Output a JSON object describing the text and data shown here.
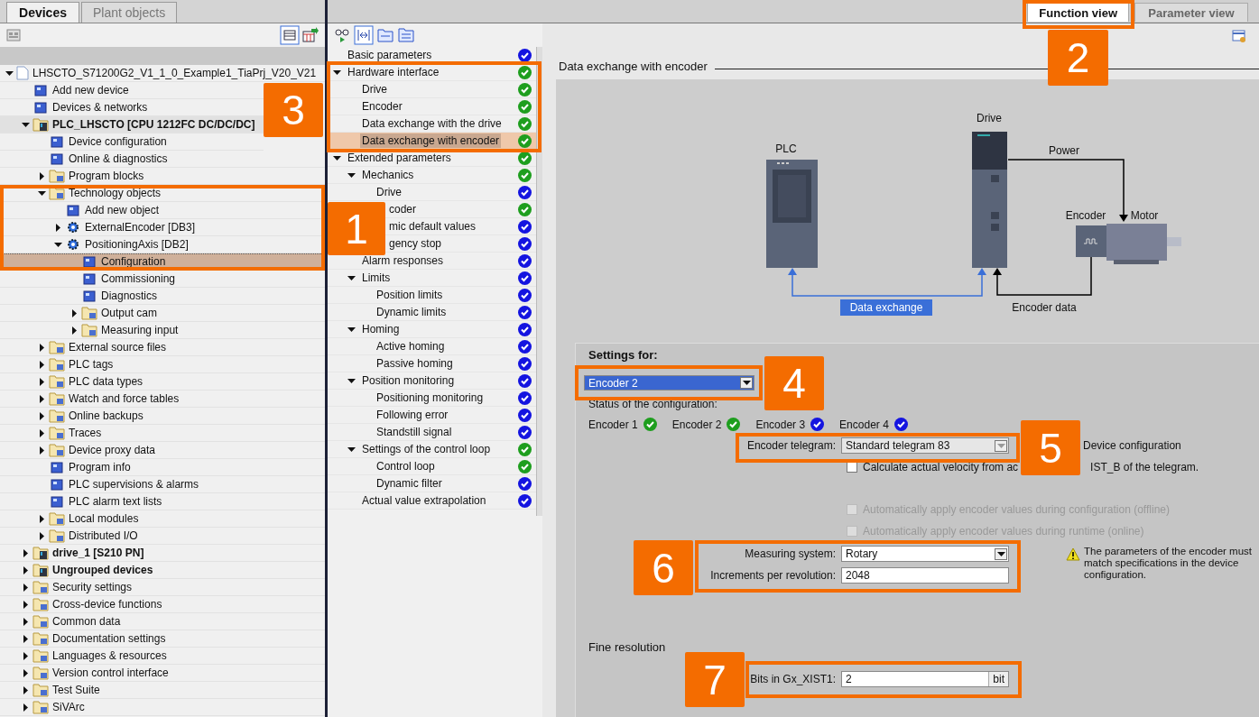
{
  "explorer": {
    "tabs": [
      {
        "label": "Devices",
        "selected": true
      },
      {
        "label": "Plant objects",
        "selected": false
      }
    ],
    "tree": [
      {
        "label": "LHSCTO_S71200G2_V1_1_0_Example1_TiaPrj_V20_V21",
        "kind": "root",
        "expanded": true,
        "selected": false,
        "children": [
          {
            "label": "Add new device",
            "kind": "item",
            "selected": false
          },
          {
            "label": "Devices & networks",
            "kind": "item",
            "selected": false
          },
          {
            "label": "PLC_LHSCTO [CPU 1212FC DC/DC/DC]",
            "kind": "device",
            "expanded": true,
            "selected": false,
            "children": [
              {
                "label": "Device configuration",
                "kind": "item",
                "selected": false
              },
              {
                "label": "Online & diagnostics",
                "kind": "item",
                "selected": false
              },
              {
                "label": "Program blocks",
                "kind": "folder",
                "expanded": false,
                "selected": false
              },
              {
                "label": "Technology objects",
                "kind": "folder",
                "expanded": true,
                "selected": false,
                "children": [
                  {
                    "label": "Add new object",
                    "kind": "item",
                    "selected": false
                  },
                  {
                    "label": "ExternalEncoder [DB3]",
                    "kind": "object",
                    "expanded": false,
                    "selected": false
                  },
                  {
                    "label": "PositioningAxis [DB2]",
                    "kind": "object",
                    "expanded": true,
                    "selected": false,
                    "children": [
                      {
                        "label": "Configuration",
                        "kind": "item",
                        "selected": true
                      },
                      {
                        "label": "Commissioning",
                        "kind": "item",
                        "selected": false
                      },
                      {
                        "label": "Diagnostics",
                        "kind": "item",
                        "selected": false
                      },
                      {
                        "label": "Output cam",
                        "kind": "folder",
                        "expanded": false,
                        "selected": false
                      },
                      {
                        "label": "Measuring input",
                        "kind": "folder",
                        "expanded": false,
                        "selected": false
                      }
                    ]
                  }
                ]
              },
              {
                "label": "External source files",
                "kind": "folder",
                "expanded": false,
                "selected": false
              },
              {
                "label": "PLC tags",
                "kind": "folder",
                "expanded": false,
                "selected": false
              },
              {
                "label": "PLC data types",
                "kind": "folder",
                "expanded": false,
                "selected": false
              },
              {
                "label": "Watch and force tables",
                "kind": "folder",
                "expanded": false,
                "selected": false
              },
              {
                "label": "Online backups",
                "kind": "folder",
                "expanded": false,
                "selected": false
              },
              {
                "label": "Traces",
                "kind": "folder",
                "expanded": false,
                "selected": false
              },
              {
                "label": "Device proxy data",
                "kind": "folder",
                "expanded": false,
                "selected": false
              },
              {
                "label": "Program info",
                "kind": "item",
                "selected": false
              },
              {
                "label": "PLC supervisions & alarms",
                "kind": "item",
                "selected": false
              },
              {
                "label": "PLC alarm text lists",
                "kind": "item",
                "selected": false
              },
              {
                "label": "Local modules",
                "kind": "folder",
                "expanded": false,
                "selected": false
              },
              {
                "label": "Distributed I/O",
                "kind": "folder",
                "expanded": false,
                "selected": false
              }
            ]
          },
          {
            "label": "drive_1 [S210 PN]",
            "kind": "device",
            "expanded": false,
            "selected": false
          },
          {
            "label": "Ungrouped devices",
            "kind": "device",
            "expanded": false,
            "selected": false
          },
          {
            "label": "Security settings",
            "kind": "folder",
            "expanded": false,
            "selected": false
          },
          {
            "label": "Cross-device functions",
            "kind": "folder",
            "expanded": false,
            "selected": false
          },
          {
            "label": "Common data",
            "kind": "folder",
            "expanded": false,
            "selected": false
          },
          {
            "label": "Documentation settings",
            "kind": "folder",
            "expanded": false,
            "selected": false
          },
          {
            "label": "Languages & resources",
            "kind": "folder",
            "expanded": false,
            "selected": false
          },
          {
            "label": "Version control interface",
            "kind": "folder",
            "expanded": false,
            "selected": false
          },
          {
            "label": "Test Suite",
            "kind": "folder",
            "expanded": false,
            "selected": false
          },
          {
            "label": "SiVArc",
            "kind": "folder",
            "expanded": false,
            "selected": false
          }
        ]
      }
    ]
  },
  "navigation": [
    {
      "label": "Basic parameters",
      "color": "#1414e0",
      "selected": false
    },
    {
      "label": "Hardware interface",
      "color": "#1e9e1e",
      "expanded": true,
      "selected": false,
      "children": [
        {
          "label": "Drive",
          "color": "#1e9e1e",
          "selected": false
        },
        {
          "label": "Encoder",
          "color": "#1e9e1e",
          "selected": false
        },
        {
          "label": "Data exchange with the drive",
          "color": "#1e9e1e",
          "selected": false
        },
        {
          "label": "Data exchange with encoder",
          "color": "#1e9e1e",
          "selected": true
        }
      ]
    },
    {
      "label": "Extended parameters",
      "color": "#1e9e1e",
      "expanded": true,
      "selected": false,
      "children": [
        {
          "label": "Mechanics",
          "color": "#1e9e1e",
          "expanded": true,
          "selected": false,
          "children": [
            {
              "label": "Drive",
              "color": "#1414e0",
              "selected": false
            },
            {
              "label": "coder",
              "color": "#1e9e1e",
              "selected": false
            }
          ]
        },
        {
          "label": "mic default values",
          "color": "#1414e0",
          "selected": false
        },
        {
          "label": "gency stop",
          "color": "#1414e0",
          "selected": false
        },
        {
          "label": "Alarm responses",
          "color": "#1414e0",
          "selected": false
        },
        {
          "label": "Limits",
          "color": "#1414e0",
          "expanded": true,
          "selected": false,
          "children": [
            {
              "label": "Position limits",
              "color": "#1414e0",
              "selected": false
            },
            {
              "label": "Dynamic limits",
              "color": "#1414e0",
              "selected": false
            }
          ]
        },
        {
          "label": "Homing",
          "color": "#1414e0",
          "expanded": true,
          "selected": false,
          "children": [
            {
              "label": "Active homing",
              "color": "#1414e0",
              "selected": false
            },
            {
              "label": "Passive homing",
              "color": "#1414e0",
              "selected": false
            }
          ]
        },
        {
          "label": "Position monitoring",
          "color": "#1414e0",
          "expanded": true,
          "selected": false,
          "children": [
            {
              "label": "Positioning monitoring",
              "color": "#1414e0",
              "selected": false
            },
            {
              "label": "Following error",
              "color": "#1414e0",
              "selected": false
            },
            {
              "label": "Standstill signal",
              "color": "#1414e0",
              "selected": false
            }
          ]
        },
        {
          "label": "Settings of the control loop",
          "color": "#1e9e1e",
          "expanded": true,
          "selected": false,
          "children": [
            {
              "label": "Control loop",
              "color": "#1e9e1e",
              "selected": false
            },
            {
              "label": "Dynamic filter",
              "color": "#1414e0",
              "selected": false
            }
          ]
        },
        {
          "label": "Actual value extrapolation",
          "color": "#1414e0",
          "selected": false
        }
      ]
    }
  ],
  "view_tabs": [
    {
      "label": "Function view",
      "selected": true
    },
    {
      "label": "Parameter view",
      "selected": false
    }
  ],
  "section_title": "Data exchange with encoder",
  "diagram": {
    "plc": "PLC",
    "drive": "Drive",
    "power": "Power",
    "encoder": "Encoder",
    "motor": "Motor",
    "data_exchange": "Data exchange",
    "encoder_data": "Encoder data"
  },
  "settings": {
    "title": "Settings for:",
    "encoder_select": "Encoder 2",
    "status_label": "Status of the configuration:",
    "encoders": [
      {
        "label": "Encoder 1",
        "color": "#1e9e1e"
      },
      {
        "label": "Encoder 2",
        "color": "#1e9e1e"
      },
      {
        "label": "Encoder 3",
        "color": "#1414e0"
      },
      {
        "label": "Encoder 4",
        "color": "#1414e0"
      }
    ],
    "telegram": {
      "label": "Encoder telegram:",
      "value": "Standard telegram 83",
      "disabled": true
    },
    "device_configuration": "Device configuration",
    "velocity_option": {
      "text_before": "Calculate actual velocity from ac",
      "text_after": "IST_B of the telegram.",
      "checked": false,
      "disabled": false
    },
    "auto_options": [
      {
        "label": "Automatically apply encoder values during configuration (offline)",
        "checked": false,
        "disabled": true
      },
      {
        "label": "Automatically apply encoder values during runtime (online)",
        "checked": false,
        "disabled": true
      }
    ],
    "measuring_system": {
      "label": "Measuring system:",
      "value": "Rotary"
    },
    "increments": {
      "label": "Increments per revolution:",
      "value": "2048"
    },
    "warning": "The parameters of the encoder must match specifications in the device configuration.",
    "fine_resolution": {
      "title": "Fine resolution",
      "label": "Bits in Gx_XIST1:",
      "value": "2",
      "unit": "bit"
    }
  },
  "callouts": [
    {
      "number": "1"
    },
    {
      "number": "2"
    },
    {
      "number": "3"
    },
    {
      "number": "4"
    },
    {
      "number": "5"
    },
    {
      "number": "6"
    },
    {
      "number": "7"
    }
  ]
}
